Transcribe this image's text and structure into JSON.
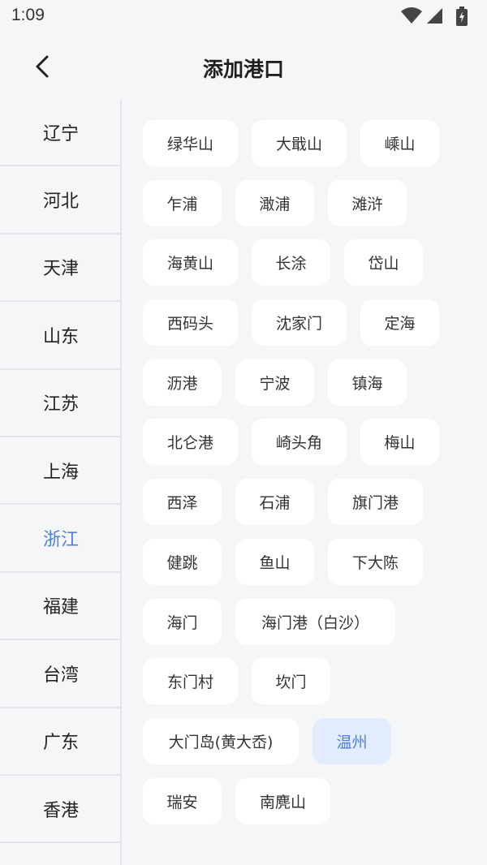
{
  "status_bar": {
    "time": "1:09"
  },
  "header": {
    "title": "添加港口"
  },
  "sidebar": {
    "items": [
      "辽宁",
      "河北",
      "天津",
      "山东",
      "江苏",
      "上海",
      "浙江",
      "福建",
      "台湾",
      "广东",
      "香港"
    ],
    "active_item": "浙江"
  },
  "ports": [
    [
      "绿华山",
      "大戢山",
      "嵊山"
    ],
    [
      "乍浦",
      "澉浦",
      "滩浒"
    ],
    [
      "海黄山",
      "长涂",
      "岱山"
    ],
    [
      "西码头",
      "沈家门",
      "定海"
    ],
    [
      "沥港",
      "宁波",
      "镇海"
    ],
    [
      "北仑港",
      "崎头角",
      "梅山"
    ],
    [
      "西泽",
      "石浦",
      "旗门港"
    ],
    [
      "健跳",
      "鱼山",
      "下大陈"
    ],
    [
      "海门",
      "海门港（白沙）"
    ],
    [
      "东门村",
      "坎门"
    ],
    [
      "大门岛(黄大岙)",
      "温州"
    ],
    [
      "瑞安",
      "南麂山"
    ]
  ],
  "selected_port": "温州",
  "colors": {
    "accent": "#4f7fe0",
    "selected_bg": "#e2ecfc",
    "page_bg": "#f5f6f8"
  }
}
